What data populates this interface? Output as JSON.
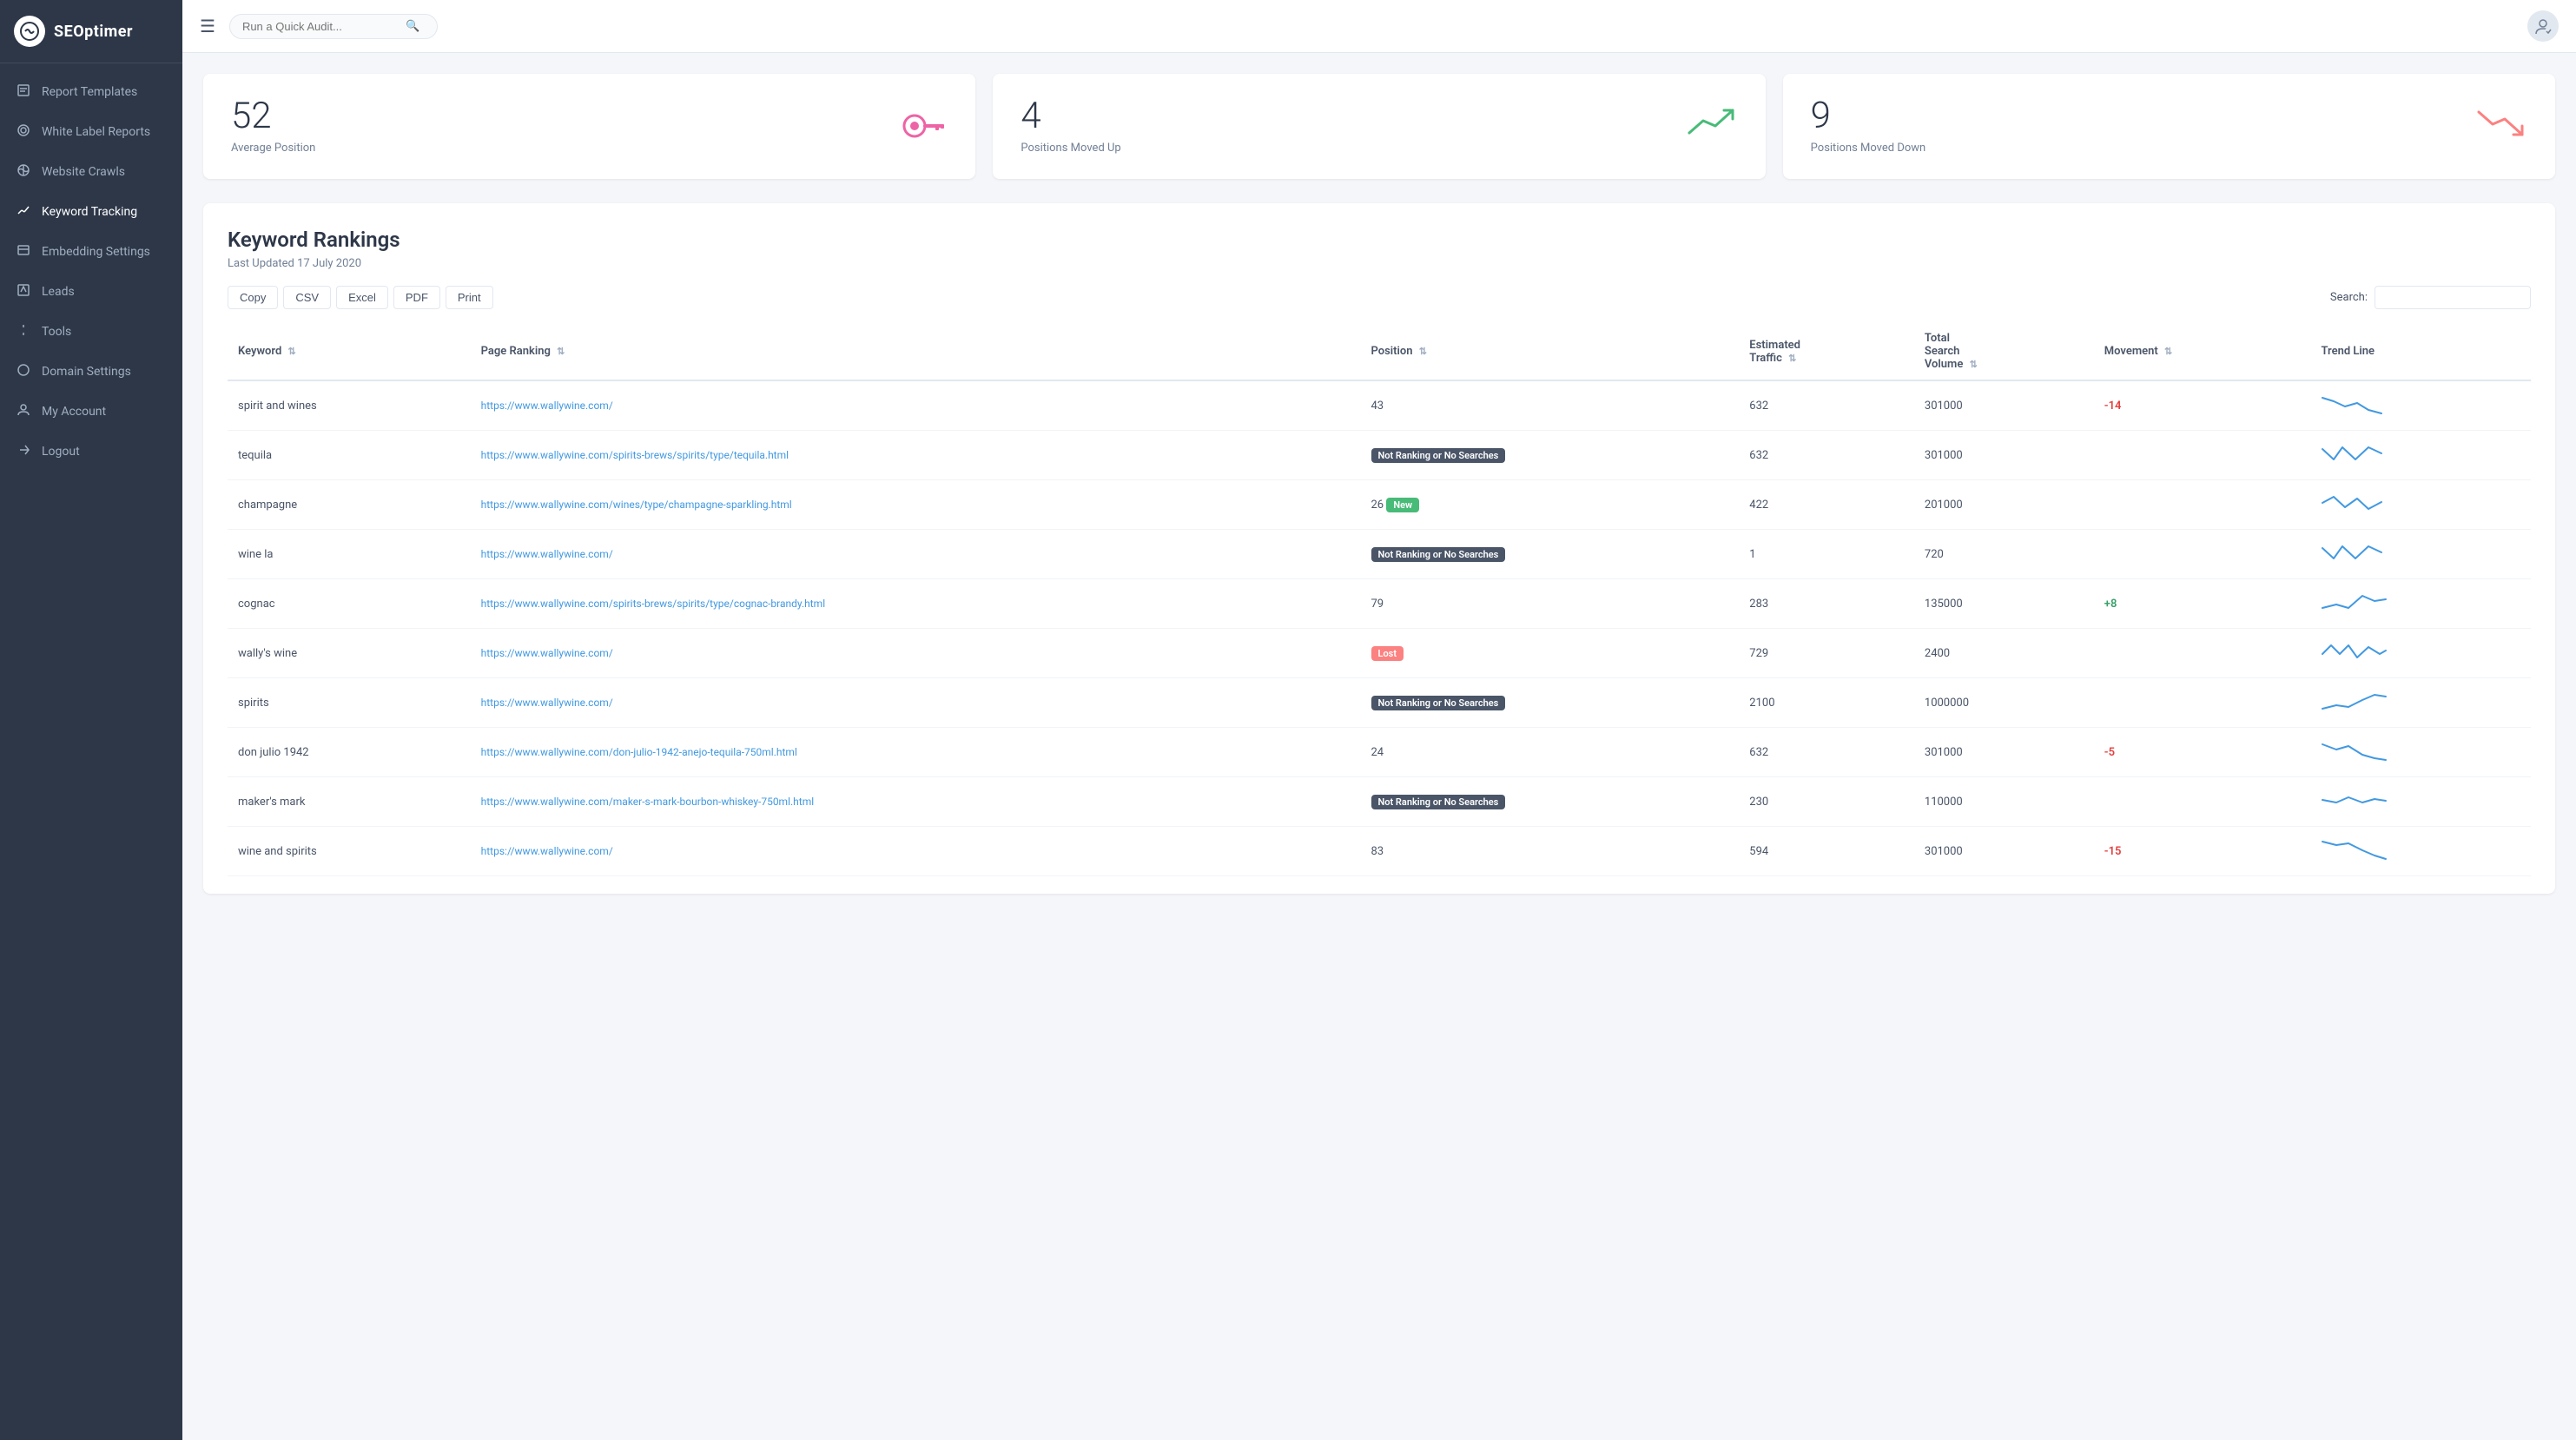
{
  "brand": {
    "logo_text": "SEOptimer",
    "logo_icon": "⚙"
  },
  "sidebar": {
    "items": [
      {
        "id": "report-templates",
        "label": "Report Templates",
        "icon": "📄"
      },
      {
        "id": "white-label-reports",
        "label": "White Label Reports",
        "icon": "🔍"
      },
      {
        "id": "website-crawls",
        "label": "Website Crawls",
        "icon": "🌐"
      },
      {
        "id": "keyword-tracking",
        "label": "Keyword Tracking",
        "icon": "📌",
        "active": true
      },
      {
        "id": "embedding-settings",
        "label": "Embedding Settings",
        "icon": "📋"
      },
      {
        "id": "leads",
        "label": "Leads",
        "icon": "📥"
      },
      {
        "id": "tools",
        "label": "Tools",
        "icon": "🔧"
      },
      {
        "id": "domain-settings",
        "label": "Domain Settings",
        "icon": "🌍"
      },
      {
        "id": "my-account",
        "label": "My Account",
        "icon": "⚙"
      },
      {
        "id": "logout",
        "label": "Logout",
        "icon": "↗"
      }
    ]
  },
  "topbar": {
    "search_placeholder": "Run a Quick Audit..."
  },
  "stat_cards": [
    {
      "id": "avg-position",
      "number": "52",
      "label": "Average Position",
      "icon_type": "key",
      "icon_color": "#ed64a6"
    },
    {
      "id": "positions-up",
      "number": "4",
      "label": "Positions Moved Up",
      "icon_type": "trending-up",
      "icon_color": "#48bb78"
    },
    {
      "id": "positions-down",
      "number": "9",
      "label": "Positions Moved Down",
      "icon_type": "trending-down",
      "icon_color": "#fc8181"
    }
  ],
  "table_section": {
    "title": "Keyword Rankings",
    "subtitle": "Last Updated 17 July 2020",
    "buttons": [
      "Copy",
      "CSV",
      "Excel",
      "PDF",
      "Print"
    ],
    "search_label": "Search:",
    "search_placeholder": "",
    "columns": [
      {
        "id": "keyword",
        "label": "Keyword",
        "sortable": true
      },
      {
        "id": "page-ranking",
        "label": "Page Ranking",
        "sortable": true
      },
      {
        "id": "position",
        "label": "Position",
        "sortable": true
      },
      {
        "id": "estimated-traffic",
        "label": "Estimated Traffic",
        "sortable": true
      },
      {
        "id": "total-search-volume",
        "label": "Total Search Volume",
        "sortable": true
      },
      {
        "id": "movement",
        "label": "Movement",
        "sortable": true
      },
      {
        "id": "trend-line",
        "label": "Trend Line",
        "sortable": false
      }
    ],
    "rows": [
      {
        "keyword": "spirit and wines",
        "page_ranking": "https://www.wallywine.com/",
        "position": "43",
        "position_badge": null,
        "estimated_traffic": "632",
        "total_search_volume": "301000",
        "movement": "-14",
        "movement_type": "neg",
        "trend": "down"
      },
      {
        "keyword": "tequila",
        "page_ranking": "https://www.wallywine.com/spirits-brews/spirits/type/tequila.html",
        "position": null,
        "position_badge": "Not Ranking or No Searches",
        "position_badge_type": "dark",
        "estimated_traffic": "632",
        "total_search_volume": "301000",
        "movement": "",
        "movement_type": "none",
        "trend": "dip"
      },
      {
        "keyword": "champagne",
        "page_ranking": "https://www.wallywine.com/wines/type/champagne-sparkling.html",
        "position": "26",
        "position_badge": "New",
        "position_badge_type": "green",
        "estimated_traffic": "422",
        "total_search_volume": "201000",
        "movement": "",
        "movement_type": "none",
        "trend": "dip2"
      },
      {
        "keyword": "wine la",
        "page_ranking": "https://www.wallywine.com/",
        "position": null,
        "position_badge": "Not Ranking or No Searches",
        "position_badge_type": "dark",
        "estimated_traffic": "1",
        "total_search_volume": "720",
        "movement": "",
        "movement_type": "none",
        "trend": "dip"
      },
      {
        "keyword": "cognac",
        "page_ranking": "https://www.wallywine.com/spirits-brews/spirits/type/cognac-brandy.html",
        "position": "79",
        "position_badge": null,
        "estimated_traffic": "283",
        "total_search_volume": "135000",
        "movement": "+8",
        "movement_type": "pos",
        "trend": "down-flat"
      },
      {
        "keyword": "wally's wine",
        "page_ranking": "https://www.wallywine.com/",
        "position": null,
        "position_badge": "Lost",
        "position_badge_type": "red",
        "estimated_traffic": "729",
        "total_search_volume": "2400",
        "movement": "",
        "movement_type": "none",
        "trend": "wave"
      },
      {
        "keyword": "spirits",
        "page_ranking": "https://www.wallywine.com/",
        "position": null,
        "position_badge": "Not Ranking or No Searches",
        "position_badge_type": "dark",
        "estimated_traffic": "2100",
        "total_search_volume": "1000000",
        "movement": "",
        "movement_type": "none",
        "trend": "rise"
      },
      {
        "keyword": "don julio 1942",
        "page_ranking": "https://www.wallywine.com/don-julio-1942-anejo-tequila-750ml.html",
        "position": "24",
        "position_badge": null,
        "estimated_traffic": "632",
        "total_search_volume": "301000",
        "movement": "-5",
        "movement_type": "neg",
        "trend": "down2"
      },
      {
        "keyword": "maker's mark",
        "page_ranking": "https://www.wallywine.com/maker-s-mark-bourbon-whiskey-750ml.html",
        "position": null,
        "position_badge": "Not Ranking or No Searches",
        "position_badge_type": "dark",
        "estimated_traffic": "230",
        "total_search_volume": "110000",
        "movement": "",
        "movement_type": "none",
        "trend": "flat"
      },
      {
        "keyword": "wine and spirits",
        "page_ranking": "https://www.wallywine.com/",
        "position": "83",
        "position_badge": null,
        "estimated_traffic": "594",
        "total_search_volume": "301000",
        "movement": "-15",
        "movement_type": "neg",
        "trend": "down3"
      }
    ]
  }
}
